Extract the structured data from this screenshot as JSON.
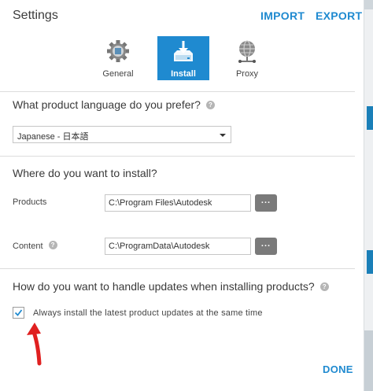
{
  "header": {
    "title": "Settings",
    "import_label": "IMPORT",
    "export_label": "EXPORT"
  },
  "tabs": [
    {
      "label": "General",
      "icon": "gear-icon"
    },
    {
      "label": "Install",
      "icon": "install-tray-icon",
      "selected": true
    },
    {
      "label": "Proxy",
      "icon": "globe-network-icon"
    }
  ],
  "language": {
    "question": "What product language do you prefer?",
    "selected": "Japanese - 日本語"
  },
  "install": {
    "question": "Where do you want to install?",
    "products_label": "Products",
    "products_path": "C:\\Program Files\\Autodesk",
    "content_label": "Content",
    "content_path": "C:\\ProgramData\\Autodesk",
    "browse_label": "..."
  },
  "updates": {
    "question": "How do you want to handle updates when installing products?",
    "checkbox_label": "Always install the latest product updates at the same time",
    "checked": true
  },
  "footer": {
    "done_label": "DONE"
  },
  "colors": {
    "accent": "#1f8ad0",
    "annotation_arrow": "#e02020",
    "browse_button": "#7a7a7a"
  }
}
